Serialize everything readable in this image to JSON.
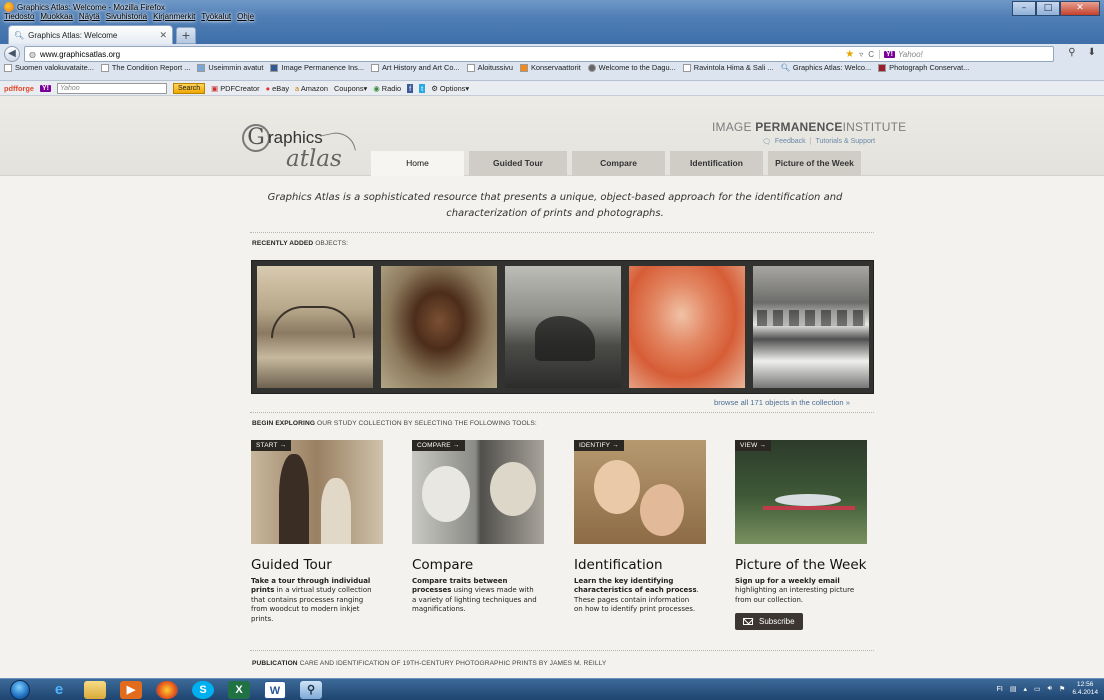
{
  "window": {
    "title": "Graphics Atlas: Welcome - Mozilla Firefox",
    "menu": [
      "Tiedosto",
      "Muokkaa",
      "Näytä",
      "Sivuhistoria",
      "Kirjanmerkit",
      "Työkalut",
      "Ohje"
    ],
    "tab_label": "Graphics Atlas: Welcome",
    "new_tab": "+"
  },
  "navbar": {
    "url": "www.graphicsatlas.org",
    "search_placeholder": "Yahoo!",
    "search_engine": "Y!"
  },
  "bookmarks": [
    "Suomen valokuvataite...",
    "The Condition Report ...",
    "Useimmin avatut",
    "Image Permanence Ins...",
    "Art History and Art Co...",
    "Aloitussivu",
    "Konservaattorit",
    "Welcome to the Dagu...",
    "Ravintola Hima & Sali ...",
    "Graphics Atlas: Welco...",
    "Photograph Conservat..."
  ],
  "pdfbar": {
    "brand": "pdfforge",
    "search_placeholder": "Yahoo",
    "search_label": "Search",
    "items": [
      "PDFCreator",
      "eBay",
      "Amazon",
      "Coupons",
      "Radio",
      "Options"
    ]
  },
  "site": {
    "logo_g": "G",
    "logo_graphics": "raphics",
    "logo_atlas": "atlas",
    "ipi_prefix": "IMAGE",
    "ipi_bold": "PERMANENCE",
    "ipi_suffix": "INSTITUTE",
    "feedback": "Feedback",
    "tutorials": "Tutorials & Support",
    "nav": [
      "Home",
      "Guided Tour",
      "Compare",
      "Identification",
      "Picture of the Week"
    ],
    "tagline": "Graphics Atlas is a sophisticated resource that presents a unique, object-based approach for the identification and characterization of prints and photographs.",
    "recent_bold": "RECENTLY ADDED",
    "recent_rest": "OBJECTS:",
    "browse": "browse all 171 objects in the collection »",
    "explore_bold": "BEGIN EXPLORING",
    "explore_rest": "OUR STUDY COLLECTION BY SELECTING THE FOLLOWING TOOLS:",
    "cards": [
      {
        "tag": "START →",
        "title": "Guided Tour",
        "desc_bold": "Take a tour through individual prints",
        "desc_rest": " in a virtual study collection that contains processes ranging from woodcut to modern inkjet prints."
      },
      {
        "tag": "COMPARE →",
        "title": "Compare",
        "desc_bold": "Compare traits between processes",
        "desc_rest": " using views made with a variety of lighting techniques and magnifications."
      },
      {
        "tag": "IDENTIFY →",
        "title": "Identification",
        "desc_bold": "Learn the key identifying characteristics of each process",
        "desc_rest": ". These pages contain information on how to identify print processes."
      },
      {
        "tag": "VIEW →",
        "title": "Picture of the Week",
        "desc_bold": "Sign up for a weekly email",
        "desc_rest": " highlighting an interesting picture from our collection."
      }
    ],
    "subscribe": "Subscribe",
    "publication_bold": "PUBLICATION",
    "publication_rest": "CARE AND IDENTIFICATION OF 19TH-CENTURY PHOTOGRAPHIC PRINTS BY JAMES M. REILLY"
  },
  "taskbar": {
    "lang": "FI",
    "time": "12:56",
    "date": "6.4.2014"
  }
}
